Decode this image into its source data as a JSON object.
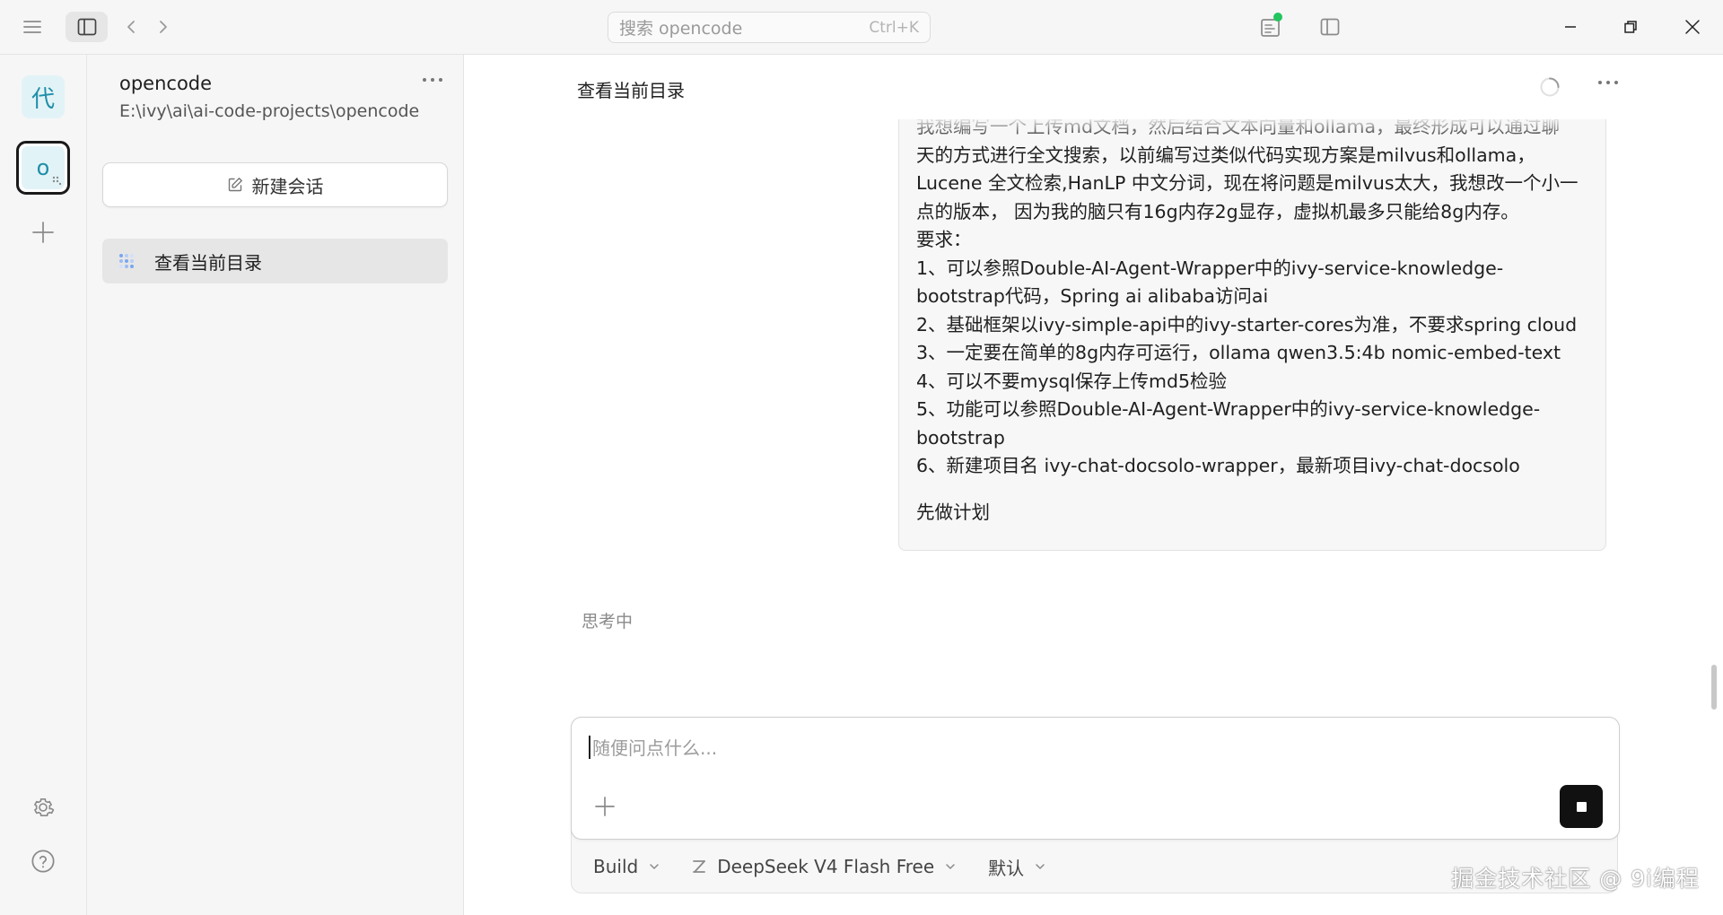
{
  "titlebar": {
    "search_placeholder": "搜索 opencode",
    "search_shortcut": "Ctrl+K"
  },
  "rail": {
    "projects": [
      {
        "glyph": "代"
      },
      {
        "glyph": "o"
      }
    ]
  },
  "sessions_panel": {
    "project_name": "opencode",
    "project_path": "E:\\ivy\\ai\\ai-code-projects\\opencode",
    "new_session_label": "新建会话",
    "items": [
      {
        "label": "查看当前目录"
      }
    ]
  },
  "conversation": {
    "title": "查看当前目录",
    "user_message_lines": [
      "我想编写一个上传md文档，然后结合文本向量和ollama，最终形成可以通过聊",
      "天的方式进行全文搜索，以前编写过类似代码实现方案是milvus和ollama，",
      "Lucene 全文检索,HanLP 中文分词，现在将问题是milvus太大，我想改一个小一",
      "点的版本， 因为我的脑只有16g内存2g显存，虚拟机最多只能给8g内存。",
      "要求：",
      "1、可以参照Double-AI-Agent-Wrapper中的ivy-service-knowledge-",
      "bootstrap代码，Spring ai alibaba访问ai",
      "2、基础框架以ivy-simple-api中的ivy-starter-cores为准，不要求spring cloud",
      "3、一定要在简单的8g内存可运行，ollama qwen3.5:4b nomic-embed-text",
      "4、可以不要mysql保存上传md5检验",
      "5、功能可以参照Double-AI-Agent-Wrapper中的ivy-service-knowledge-",
      "bootstrap",
      "6、新建项目名  ivy-chat-docsolo-wrapper，最新项目ivy-chat-docsolo",
      "",
      "先做计划"
    ],
    "status_text": "思考中"
  },
  "composer": {
    "placeholder": "随便问点什么...",
    "agent_label": "Build",
    "model_label": "DeepSeek V4 Flash Free",
    "variant_label": "默认"
  },
  "watermark": "掘金技术社区 @ 9i编程",
  "colors": {
    "accent_tile_bg": "#e2f3f7",
    "accent_tile_fg": "#1f8ea8",
    "status_dot": "#22c55e",
    "stop_button": "#111111"
  }
}
